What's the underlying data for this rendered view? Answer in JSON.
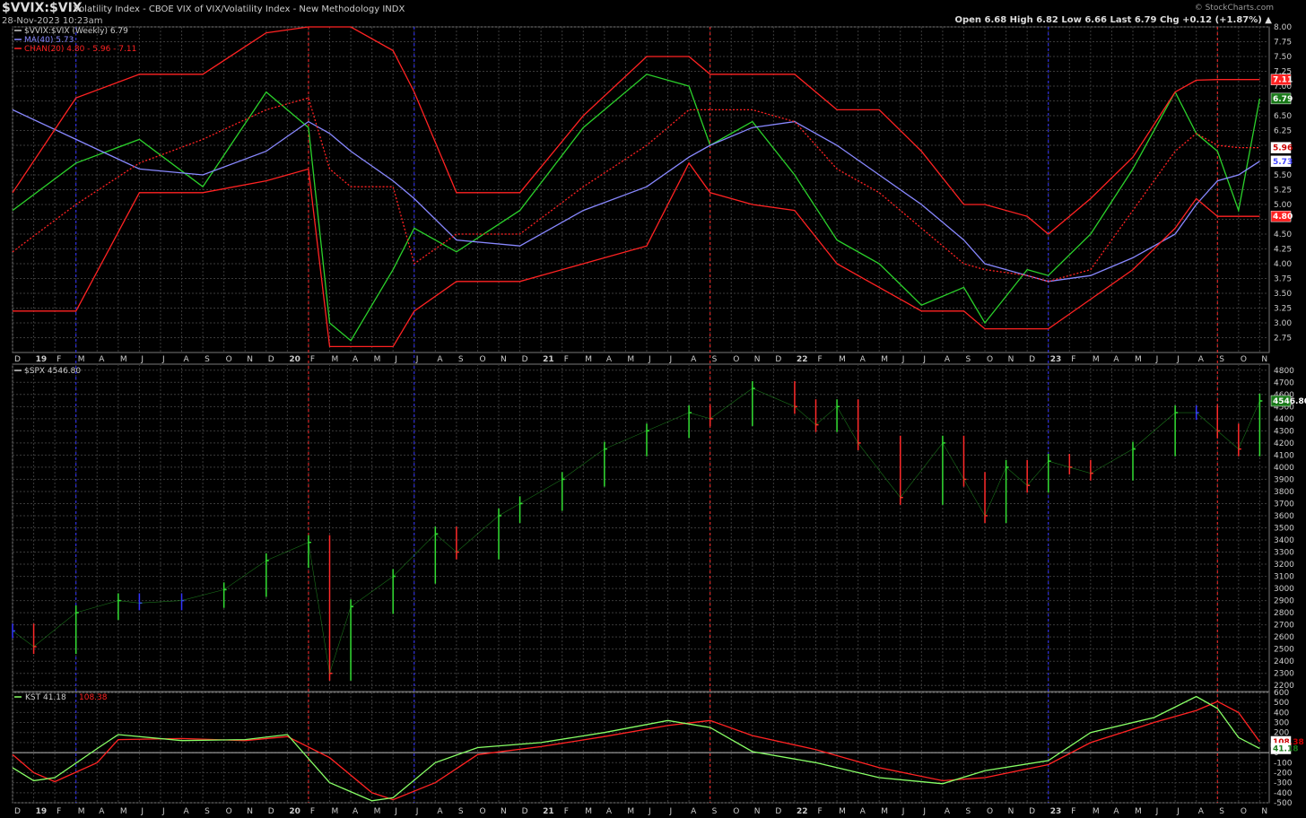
{
  "header": {
    "symbol": "$VVIX:$VIX",
    "title": "Volatility Index - CBOE VIX of VIX/Volatility Index - New Methodology INDX",
    "date": "28-Nov-2023 10:23am",
    "brand": "© StockCharts.com",
    "ohlc": "Open 6.68  High 6.82  Low 6.66  Last 6.79  Chg +0.12 (+1.87%) ▲"
  },
  "colors": {
    "ratio": "#2bd12b",
    "ma": "#8888ff",
    "chan": "#ff2222",
    "up": "#33dd33",
    "down": "#ff2a2a",
    "neutral": "#3333ff",
    "kst": "#88ff66",
    "signal": "#ff2222",
    "grid": "#3a3a3a"
  },
  "legend": {
    "ratio": "$VVIX:$VIX (Weekly) 6.79",
    "ma": "MA(40) 5.73",
    "chan": "CHAN(20) 4.80 - 5.96 - 7.11",
    "spx": "$SPX 4546.80",
    "kst_name": "KST 41.18",
    "kst_signal": "108.38"
  },
  "badges": {
    "chan_upper": "7.11",
    "ratio_last": "6.79",
    "chan_mid": "5.96",
    "ma_last": "5.73",
    "chan_lower": "4.80",
    "spx_last": "4546.80",
    "kst_signal": "108.38",
    "kst_last": "41.18"
  },
  "x_axis_labels": [
    "D",
    "19",
    "F",
    "M",
    "A",
    "M",
    "J",
    "J",
    "A",
    "S",
    "O",
    "N",
    "D",
    "20",
    "F",
    "M",
    "A",
    "M",
    "J",
    "J",
    "A",
    "S",
    "O",
    "N",
    "D",
    "21",
    "F",
    "M",
    "A",
    "M",
    "J",
    "J",
    "A",
    "S",
    "O",
    "N",
    "D",
    "22",
    "F",
    "M",
    "A",
    "M",
    "J",
    "J",
    "A",
    "S",
    "O",
    "N",
    "D",
    "23",
    "F",
    "M",
    "A",
    "M",
    "J",
    "J",
    "A",
    "S",
    "O",
    "N"
  ],
  "chart_data": [
    {
      "type": "line",
      "title": "$VVIX:$VIX",
      "x": [
        "2018-12",
        "2019-03",
        "2019-06",
        "2019-09",
        "2019-12",
        "2020-02",
        "2020-03",
        "2020-04",
        "2020-06",
        "2020-07",
        "2020-09",
        "2020-12",
        "2021-03",
        "2021-06",
        "2021-08",
        "2021-09",
        "2021-11",
        "2022-01",
        "2022-03",
        "2022-05",
        "2022-07",
        "2022-09",
        "2022-10",
        "2022-12",
        "2023-01",
        "2023-03",
        "2023-05",
        "2023-07",
        "2023-08",
        "2023-09",
        "2023-10",
        "2023-11"
      ],
      "series": [
        {
          "name": "$VVIX:$VIX (Weekly)",
          "values": [
            4.9,
            5.7,
            6.1,
            5.3,
            6.9,
            6.3,
            3.0,
            2.7,
            3.9,
            4.6,
            4.2,
            4.9,
            6.3,
            7.2,
            7.0,
            6.0,
            6.4,
            5.5,
            4.4,
            4.0,
            3.3,
            3.6,
            3.0,
            3.9,
            3.8,
            4.5,
            5.6,
            6.9,
            6.2,
            5.9,
            4.9,
            6.79
          ]
        },
        {
          "name": "MA(40)",
          "values": [
            6.6,
            6.1,
            5.6,
            5.5,
            5.9,
            6.4,
            6.2,
            5.9,
            5.4,
            5.1,
            4.4,
            4.3,
            4.9,
            5.3,
            5.8,
            6.0,
            6.3,
            6.4,
            6.0,
            5.5,
            5.0,
            4.4,
            4.0,
            3.8,
            3.7,
            3.8,
            4.1,
            4.5,
            5.0,
            5.4,
            5.5,
            5.73
          ]
        },
        {
          "name": "CHAN(20) upper",
          "values": [
            5.2,
            6.8,
            7.2,
            7.2,
            7.9,
            8.0,
            8.0,
            8.0,
            7.6,
            6.9,
            5.2,
            5.2,
            6.5,
            7.5,
            7.5,
            7.2,
            7.2,
            7.2,
            6.6,
            6.6,
            5.9,
            5.0,
            5.0,
            4.8,
            4.5,
            5.1,
            5.8,
            6.9,
            7.1,
            7.11,
            7.11,
            7.11
          ]
        },
        {
          "name": "CHAN(20) middle",
          "values": [
            4.2,
            5.0,
            5.7,
            6.1,
            6.6,
            6.8,
            5.6,
            5.3,
            5.3,
            4.0,
            4.5,
            4.5,
            5.3,
            6.0,
            6.6,
            6.6,
            6.6,
            6.4,
            5.6,
            5.2,
            4.6,
            4.0,
            3.9,
            3.8,
            3.7,
            3.9,
            4.9,
            5.9,
            6.2,
            6.0,
            5.96,
            5.96
          ]
        },
        {
          "name": "CHAN(20) lower",
          "values": [
            3.2,
            3.2,
            5.2,
            5.2,
            5.4,
            5.6,
            2.6,
            2.6,
            2.6,
            3.2,
            3.7,
            3.7,
            4.0,
            4.3,
            5.7,
            5.2,
            5.0,
            4.9,
            4.0,
            3.6,
            3.2,
            3.2,
            2.9,
            2.9,
            2.9,
            3.4,
            3.9,
            4.6,
            5.1,
            4.8,
            4.8,
            4.8
          ]
        }
      ],
      "ylim": [
        2.5,
        8.0
      ],
      "yticks": [
        "8.00",
        "7.75",
        "7.50",
        "7.25",
        "7.00",
        "6.75",
        "6.50",
        "6.25",
        "6.00",
        "5.75",
        "5.50",
        "5.25",
        "5.00",
        "4.75",
        "4.50",
        "4.25",
        "4.00",
        "3.75",
        "3.50",
        "3.25",
        "3.00",
        "2.75"
      ],
      "grid": true,
      "legend": "top-left"
    },
    {
      "type": "bar",
      "title": "$SPX",
      "x": [
        "2018-12",
        "2019-01",
        "2019-03",
        "2019-05",
        "2019-06",
        "2019-08",
        "2019-10",
        "2019-12",
        "2020-02",
        "2020-03",
        "2020-04",
        "2020-06",
        "2020-08",
        "2020-09",
        "2020-11",
        "2020-12",
        "2021-02",
        "2021-04",
        "2021-06",
        "2021-08",
        "2021-09",
        "2021-11",
        "2022-01",
        "2022-02",
        "2022-03",
        "2022-04",
        "2022-06",
        "2022-08",
        "2022-09",
        "2022-10",
        "2022-11",
        "2022-12",
        "2023-01",
        "2023-02",
        "2023-03",
        "2023-05",
        "2023-07",
        "2023-08",
        "2023-09",
        "2023-10",
        "2023-11"
      ],
      "values": [
        2650,
        2520,
        2800,
        2900,
        2880,
        2900,
        2990,
        3230,
        3380,
        2300,
        2850,
        3100,
        3450,
        3300,
        3600,
        3700,
        3900,
        4150,
        4300,
        4450,
        4400,
        4650,
        4500,
        4350,
        4500,
        4200,
        3750,
        4200,
        3900,
        3600,
        4000,
        3850,
        4050,
        4000,
        3950,
        4150,
        4450,
        4450,
        4300,
        4150,
        4546.8
      ],
      "ylim": [
        2150,
        4850
      ],
      "yticks": [
        "4800",
        "4700",
        "4600",
        "4500",
        "4400",
        "4300",
        "4200",
        "4100",
        "4000",
        "3900",
        "3800",
        "3700",
        "3600",
        "3500",
        "3400",
        "3300",
        "3200",
        "3100",
        "3000",
        "2900",
        "2800",
        "2700",
        "2600",
        "2500",
        "2400",
        "2300",
        "2200"
      ],
      "grid": true
    },
    {
      "type": "line",
      "title": "KST",
      "x": [
        "2018-12",
        "2019-01",
        "2019-02",
        "2019-04",
        "2019-05",
        "2019-08",
        "2019-11",
        "2020-01",
        "2020-03",
        "2020-05",
        "2020-06",
        "2020-08",
        "2020-10",
        "2021-01",
        "2021-04",
        "2021-07",
        "2021-09",
        "2021-11",
        "2022-02",
        "2022-05",
        "2022-08",
        "2022-10",
        "2023-01",
        "2023-03",
        "2023-06",
        "2023-08",
        "2023-09",
        "2023-10",
        "2023-11"
      ],
      "series": [
        {
          "name": "KST",
          "values": [
            -150,
            -280,
            -250,
            40,
            180,
            120,
            130,
            180,
            -300,
            -480,
            -450,
            -100,
            50,
            100,
            200,
            320,
            250,
            10,
            -100,
            -250,
            -310,
            -180,
            -80,
            200,
            350,
            560,
            440,
            150,
            41.18
          ]
        },
        {
          "name": "Signal",
          "values": [
            -20,
            -200,
            -290,
            -100,
            130,
            140,
            120,
            160,
            -50,
            -400,
            -470,
            -300,
            -20,
            60,
            160,
            270,
            320,
            170,
            30,
            -150,
            -280,
            -250,
            -120,
            100,
            300,
            420,
            510,
            400,
            108.38
          ]
        }
      ],
      "ylim": [
        -500,
        600
      ],
      "yticks": [
        "600",
        "500",
        "400",
        "300",
        "200",
        "100",
        "0",
        "-100",
        "-200",
        "-300",
        "-400",
        "-500"
      ],
      "grid": true
    }
  ]
}
